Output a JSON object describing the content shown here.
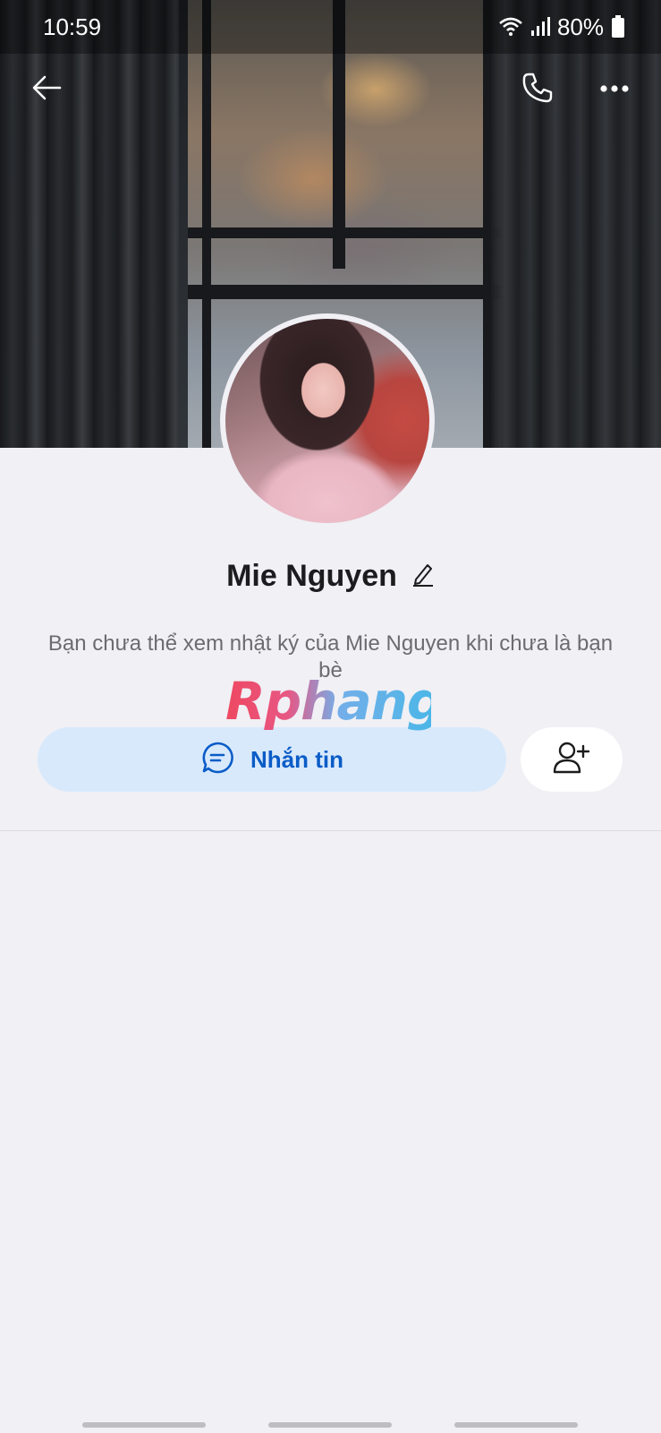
{
  "status_bar": {
    "time": "10:59",
    "battery": "80%",
    "icons": [
      "wifi-icon",
      "signal-icon",
      "battery-icon"
    ]
  },
  "top_bar": {
    "icons": [
      "back-arrow-icon",
      "phone-icon",
      "more-options-icon"
    ]
  },
  "profile": {
    "name": "Mie Nguyen",
    "notice": "Bạn chưa thể xem nhật ký của Mie Nguyen khi chưa là bạn bè"
  },
  "watermark": {
    "text": "Rphang"
  },
  "actions": {
    "message_label": "Nhắn tin",
    "message_icon": "chat-bubble-icon",
    "add_friend_icon": "add-friend-icon"
  },
  "colors": {
    "accent": "#0a5cc7",
    "message_button_bg": "#d8e9fc",
    "page_bg": "#f0f0f5"
  }
}
